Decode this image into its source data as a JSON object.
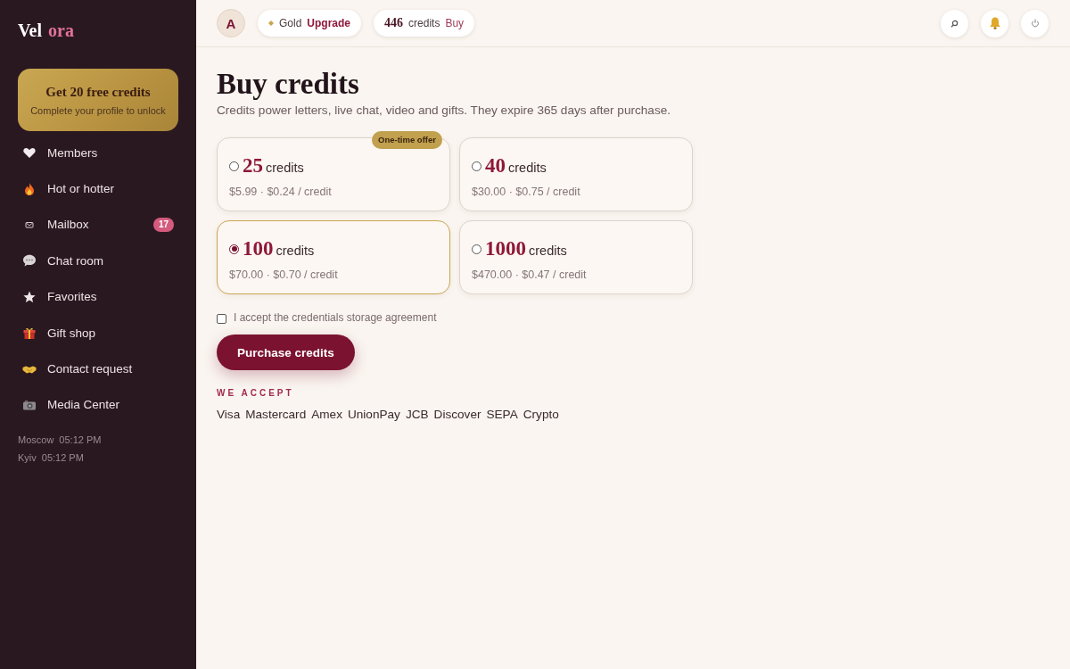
{
  "sidebar": {
    "logo": [
      {
        "text": "Vel",
        "accent": false
      },
      {
        "text": "ora",
        "accent": true
      }
    ],
    "promo": {
      "title": "Get 20 free credits",
      "subtitle": "Complete your profile to unlock"
    },
    "nav": [
      {
        "label": "Members"
      },
      {
        "label": "Hot or hotter"
      },
      {
        "label": "Mailbox",
        "badge": "17"
      },
      {
        "label": "Chat room"
      },
      {
        "label": "Favorites"
      },
      {
        "label": "Gift shop"
      },
      {
        "label": "Contact request"
      },
      {
        "label": "Media Center"
      }
    ],
    "clocks": [
      {
        "city": "Moscow",
        "time": "05:12 PM"
      },
      {
        "city": "Kyiv",
        "time": "05:12 PM"
      }
    ]
  },
  "topbar": {
    "avatar": "A",
    "plan": {
      "name": "Gold",
      "action": "Upgrade"
    },
    "credits": {
      "amount": "446",
      "label": "credits",
      "action": "Buy"
    }
  },
  "main": {
    "title": "Buy credits",
    "subtitle": "Credits power letters, live chat, video and gifts. They expire 365 days after purchase.",
    "packages": [
      {
        "amount": "25",
        "unit": "credits",
        "price": "$5.99 · $0.24 / credit",
        "selected": false,
        "badge": "One-time offer"
      },
      {
        "amount": "40",
        "unit": "credits",
        "price": "$30.00 · $0.75 / credit",
        "selected": false
      },
      {
        "amount": "100",
        "unit": "credits",
        "price": "$70.00 · $0.70 / credit",
        "selected": true
      },
      {
        "amount": "1000",
        "unit": "credits",
        "price": "$470.00 · $0.47 / credit",
        "selected": false
      }
    ],
    "agreement": {
      "label": "I accept the credentials storage agreement",
      "checked": false
    },
    "purchase_button": "Purchase credits",
    "accept_heading": "WE ACCEPT",
    "payment_methods": [
      "Visa",
      "Mastercard",
      "Amex",
      "UnionPay",
      "JCB",
      "Discover",
      "SEPA",
      "Crypto"
    ]
  }
}
